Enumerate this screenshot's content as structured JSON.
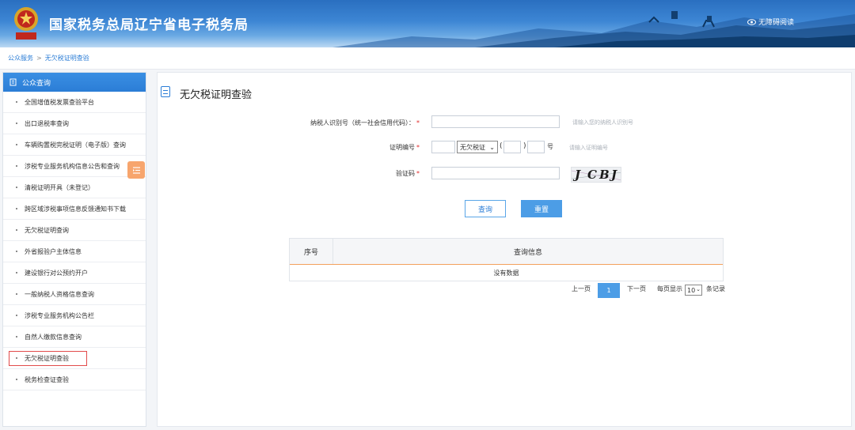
{
  "header": {
    "site_title": "国家税务总局辽宁省电子税务局",
    "accessibility_label": "无障碍阅读",
    "emblem_text": "中国税务"
  },
  "breadcrumb": {
    "root": "公众服务",
    "separator": ">",
    "current": "无欠税证明查验"
  },
  "sidebar": {
    "heading": "公众查询",
    "items": [
      "全国增值税发票查验平台",
      "出口退税率查询",
      "车辆购置税完税证明（电子版）查询",
      "涉税专业服务机构信息公告和查询",
      "清税证明开具（未登记）",
      "跨区域涉税事项信息反馈通知书下载",
      "无欠税证明查询",
      "外省报验户主体信息",
      "建设银行对公预约开户",
      "一般纳税人资格信息查询",
      "涉税专业服务机构公告栏",
      "自然人缴款信息查询",
      "无欠税证明查验",
      "税务检查证查验"
    ],
    "selected_index": 12
  },
  "form": {
    "title": "无欠税证明查验",
    "taxpayer_label": "纳税人识别号（统一社会信用代码）：",
    "taxpayer_hint": "请输入您的纳税人识别号",
    "taxpayer_value": "",
    "cert_label": "证明编号",
    "cert_type_selected": "无欠税证",
    "cert_open_paren": "(",
    "cert_close_paren": ")",
    "cert_suffix": "号",
    "cert_hint": "请输入证明编号",
    "captcha_label": "验证码",
    "captcha_value": "",
    "captcha_chars": [
      "J",
      "C",
      "B",
      "J"
    ],
    "required_mark": "*",
    "query_button": "查询",
    "reset_button": "重置"
  },
  "table": {
    "columns": [
      "序号",
      "查询信息"
    ],
    "empty_text": "没有数据"
  },
  "pager": {
    "prev": "上一页",
    "current_page": "1",
    "next": "下一页",
    "per_page_label": "每页显示",
    "per_page_value": "10",
    "records_label": "条记录"
  },
  "colors": {
    "accent": "#2b7dd6",
    "button_primary": "#4c9de6",
    "required": "#e02a2a",
    "table_rule": "#f3a15c",
    "selection_outline": "#e24b4b",
    "float_tab": "#f7a56d"
  }
}
